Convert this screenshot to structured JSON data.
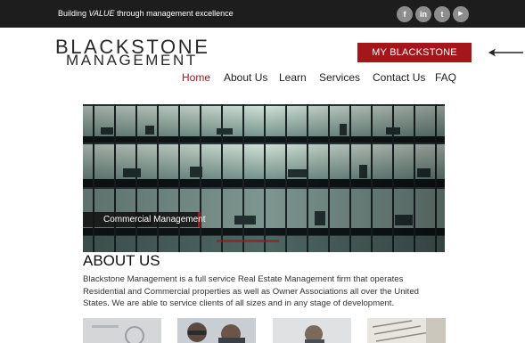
{
  "topbar": {
    "tagline_prefix": "Building ",
    "tagline_emphasis": "VALUE",
    "tagline_suffix": " through management excellence",
    "social": [
      {
        "icon": "facebook-icon",
        "glyph": "f"
      },
      {
        "icon": "linkedin-icon",
        "glyph": "in"
      },
      {
        "icon": "twitter-icon",
        "glyph": "t"
      },
      {
        "icon": "youtube-icon",
        "glyph": "▶"
      }
    ]
  },
  "logo": {
    "line1": "BLACKSTONE",
    "line2": "MANAGEMENT"
  },
  "header": {
    "my_button": "MY BLACKSTONE"
  },
  "nav": {
    "items": [
      {
        "label": "Home",
        "active": true
      },
      {
        "label": "About Us"
      },
      {
        "label": "Learn"
      },
      {
        "label": "Services"
      },
      {
        "label": "Contact Us"
      },
      {
        "label": "FAQ"
      }
    ]
  },
  "hero": {
    "caption": "Commercial Management"
  },
  "about": {
    "title": "ABOUT US",
    "paragraph": "Blackstone Management is a full service Real Estate Management  firm that operates Residential and Commercial properties as well as Owner Associations all over the United States. We are able to service clients of all sizes and in any stage of development."
  },
  "colors": {
    "brand_red": "#a5161b",
    "topbar": "#1d1d1d",
    "social_gray": "#8d8d8d"
  }
}
